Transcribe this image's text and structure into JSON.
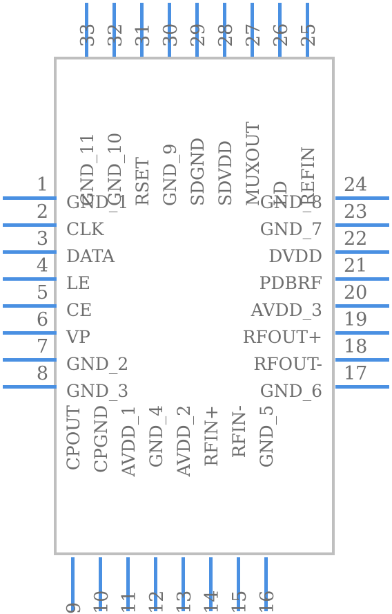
{
  "symbol": {
    "type": "ic-pinout-symbol",
    "body_color": "#bfbfbf",
    "lead_color": "#4a90e2",
    "text_color": "#6e6e6e",
    "total_pins": 33
  },
  "pins": {
    "left": [
      {
        "number": "1",
        "name": "GND_1"
      },
      {
        "number": "2",
        "name": "CLK"
      },
      {
        "number": "3",
        "name": "DATA"
      },
      {
        "number": "4",
        "name": "LE"
      },
      {
        "number": "5",
        "name": "CE"
      },
      {
        "number": "6",
        "name": "VP"
      },
      {
        "number": "7",
        "name": "GND_2"
      },
      {
        "number": "8",
        "name": "GND_3"
      }
    ],
    "bottom": [
      {
        "number": "9",
        "name": "CPOUT"
      },
      {
        "number": "10",
        "name": "CPGND"
      },
      {
        "number": "11",
        "name": "AVDD_1"
      },
      {
        "number": "12",
        "name": "GND_4"
      },
      {
        "number": "13",
        "name": "AVDD_2"
      },
      {
        "number": "14",
        "name": "RFIN+"
      },
      {
        "number": "15",
        "name": "RFIN-"
      },
      {
        "number": "16",
        "name": "GND_5"
      }
    ],
    "right": [
      {
        "number": "17",
        "name": "GND_6"
      },
      {
        "number": "18",
        "name": "RFOUT-"
      },
      {
        "number": "19",
        "name": "RFOUT+"
      },
      {
        "number": "20",
        "name": "AVDD_3"
      },
      {
        "number": "21",
        "name": "PDBRF"
      },
      {
        "number": "22",
        "name": "DVDD"
      },
      {
        "number": "23",
        "name": "GND_7"
      },
      {
        "number": "24",
        "name": "GND_8"
      }
    ],
    "top": [
      {
        "number": "25",
        "name": "REFIN"
      },
      {
        "number": "26",
        "name": "LD"
      },
      {
        "number": "27",
        "name": "MUXOUT"
      },
      {
        "number": "28",
        "name": "SDVDD"
      },
      {
        "number": "29",
        "name": "SDGND"
      },
      {
        "number": "30",
        "name": "GND_9"
      },
      {
        "number": "31",
        "name": "RSET"
      },
      {
        "number": "32",
        "name": "GND_10"
      },
      {
        "number": "33",
        "name": "GND_11"
      }
    ]
  }
}
